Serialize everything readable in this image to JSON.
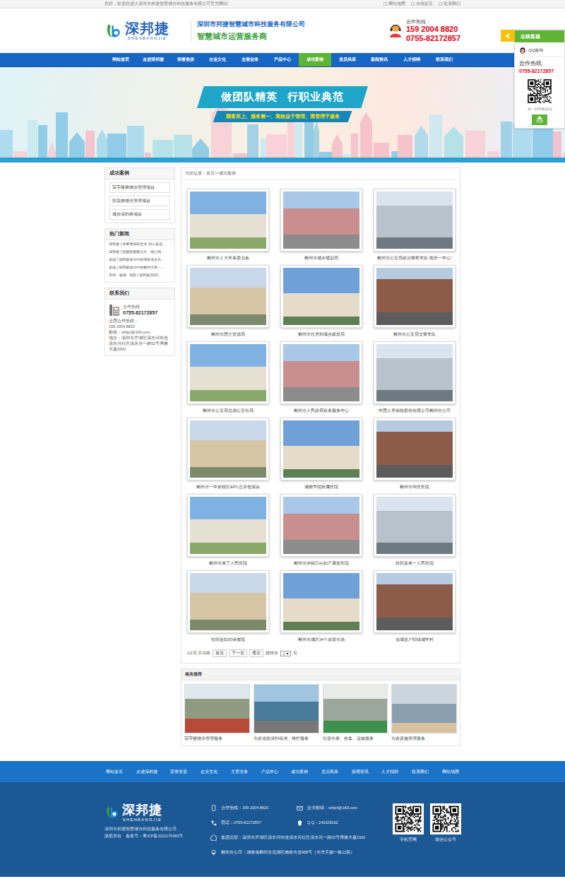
{
  "topbar": {
    "welcome": "您好，欢迎您进入深圳市邦捷智慧城市科技服务有限公司官方网站!",
    "links": [
      "网站地图",
      "在线留言",
      "联系我们"
    ]
  },
  "header": {
    "logo_text": "深邦捷",
    "logo_en": "SHENBANGJIE",
    "company": "深圳市邦捷智慧城市科技服务有限公司",
    "slogan": "智慧城市运营服务商",
    "hotline_label": "合作热线：",
    "mobile": "159 2004 8820",
    "phone": "0755-82172857"
  },
  "nav": [
    {
      "label": "网站首页",
      "selected": false
    },
    {
      "label": "走进深邦捷",
      "selected": false
    },
    {
      "label": "荣誉资质",
      "selected": false
    },
    {
      "label": "企业文化",
      "selected": false
    },
    {
      "label": "主营业务",
      "selected": false
    },
    {
      "label": "产品中心",
      "selected": false
    },
    {
      "label": "成功案例",
      "selected": true
    },
    {
      "label": "党员风采",
      "selected": false
    },
    {
      "label": "新闻资讯",
      "selected": false
    },
    {
      "label": "人才招聘",
      "selected": false
    },
    {
      "label": "联系我们",
      "selected": false
    }
  ],
  "banner": {
    "title": [
      "做团队精英",
      "行职业典范"
    ],
    "subtitle": "顾客至上、服务第一、寓效益于管理、寓管理于服务"
  },
  "float_panel": {
    "title": "在线客服",
    "qq": "QQ咨询",
    "hotline_label": "合作热线",
    "hotline": "0755-82172857",
    "qr_caption": "扫一扫手机关注",
    "top": "TOP"
  },
  "sidebar": {
    "cases": {
      "title": "成功案例",
      "items": [
        "写字楼类物业管理项目",
        "医院类物业管理项目",
        "城乡清扫类项目"
      ]
    },
    "news": {
      "title": "热门新闻",
      "items": [
        "深邦捷 | 求事情深耕意求 同心奋进...",
        "深邦捷 | 党建联建聚合力，细心同...",
        "喜报 | 深邦捷成功中标湖南省永兴...",
        "喜报 | 深邦捷成功中标郴州市第一...",
        "升维 · 破局 · 领航 | 深邦捷2025..."
      ]
    },
    "contact": {
      "title": "联系我们",
      "label": "合作热线",
      "phone": "0755-82172857",
      "lines": [
        "全国合作热线：",
        "159 2004 8820",
        "邮箱：szbjcf@163.com",
        "地址：深圳市罗湖区清水河街道清水河社区清水河一路52号博雅大厦1502"
      ]
    }
  },
  "breadcrumb": "当前位置：首页>>成功案例",
  "cases": [
    "郴州市人大常务委员会",
    "郴州市城乡规划局",
    "郴州市公安局政治警察支队“两所一中心”",
    "郴州市国土资源局",
    "郴州市住房和城乡建设局",
    "郴州市公安局交警支队",
    "郴州市公安局北湖公安分局",
    "郴州市人民政府政务服务中心",
    "中国人寿保险股份有限公司郴州分公司",
    "郴州市一中新校区EPC总承包项目",
    "湘南学院附属医院",
    "郴州市中医医院",
    "郴州市第三人民医院",
    "郴州市伊丽莎白妇产康复医院",
    "桂阳县第一人民医院",
    "桂阳县妇幼保健院",
    "郴州市城区34个农贸市场",
    "汝城县户阳镇城中村"
  ],
  "pagination": {
    "summary": "1/2页 共20条",
    "buttons": [
      "首页",
      "下一页",
      "尾页"
    ],
    "jump_label": "跳转至",
    "jump_value": "1",
    "jump_suffix": "页"
  },
  "related": {
    "title": "相关推荐",
    "items": [
      "写字楼物业管理服务",
      "市政道路清扫保洁、维护服务",
      "垃圾分类、收集、运输服务",
      "市政设施管理服务"
    ]
  },
  "footer_nav": [
    "网站首页",
    "走进深邦捷",
    "荣誉资质",
    "企业文化",
    "主营业务",
    "产品中心",
    "成功案例",
    "党员风采",
    "新闻资讯",
    "人才招聘",
    "联系我们",
    "网站地图"
  ],
  "footer": {
    "logo_text": "深邦捷",
    "logo_en": "SHENBANGJIE",
    "company": "深圳市邦捷智慧城市科技服务有限公司",
    "copyright": "版权所有",
    "icp": "备案号：粤ICP备2021175483号",
    "contacts": [
      {
        "text": "合作热线：159 2004 8820",
        "kind": "short"
      },
      {
        "text": "企业邮箱：szbjcf@163.com",
        "kind": "short"
      },
      {
        "text": "固话：0755-82172857",
        "kind": "short"
      },
      {
        "text": "Q Q：240328192",
        "kind": "short"
      },
      {
        "text": "集团总部：深圳市罗湖区清水河街道清水河社区清水河一路52号博雅大厦1502",
        "kind": "wide"
      },
      {
        "text": "郴州分公司：湖南省郴州市北湖区南岭大道968号（大华天都一栋12层）",
        "kind": "wide"
      }
    ],
    "qr": [
      "手机官网",
      "微信公众号"
    ]
  }
}
